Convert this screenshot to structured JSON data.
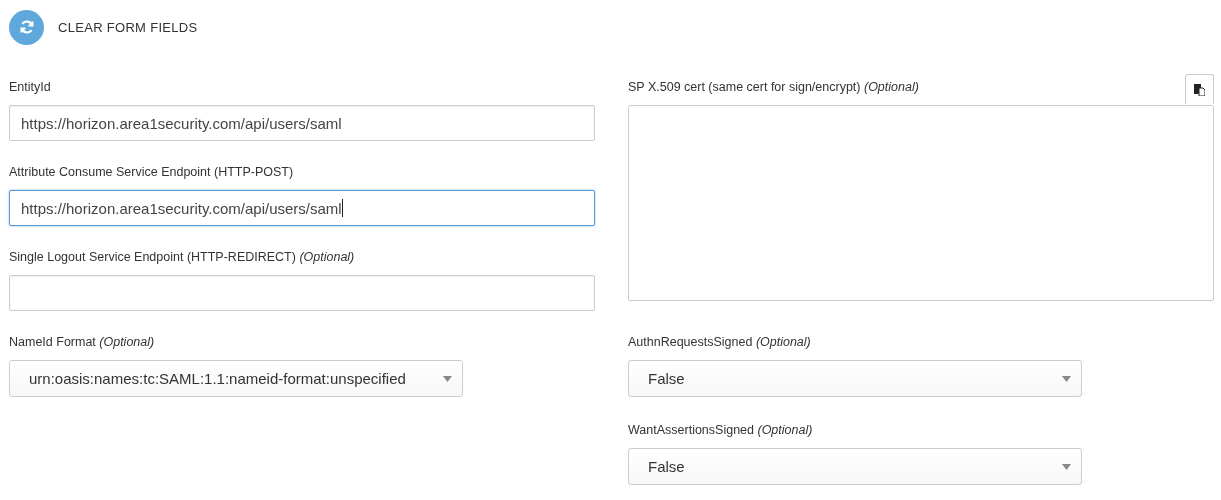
{
  "header": {
    "label": "CLEAR FORM FIELDS"
  },
  "left_fields": [
    {
      "kind": "text",
      "label": "EntityId",
      "value": "https://horizon.area1security.com/api/users/saml",
      "focused": false
    },
    {
      "kind": "text",
      "label": "Attribute Consume Service Endpoint (HTTP-POST)",
      "value": "https://horizon.area1security.com/api/users/saml",
      "focused": true
    },
    {
      "kind": "text",
      "label": "Single Logout Service Endpoint (HTTP-REDIRECT) *(Optional)*",
      "focused": false
    }
  ],
  "right_fields": [
    {
      "kind": "textarea",
      "label": "SP X.509 cert (same cert for sign/encrypt) *(Optional)*"
    }
  ],
  "left_selects": [
    {
      "kind": "select",
      "label": "NameId Format *(Optional)*",
      "value": "urn:oasis:names:tc:SAML:1.1:nameid-format:unspecified"
    }
  ],
  "right_selects": [
    {
      "kind": "select",
      "label": "AuthnRequestsSigned *(Optional)*",
      "value": "False"
    },
    {
      "kind": "select",
      "label": "WantAssertionsSigned *(Optional)*",
      "value": "False"
    }
  ]
}
